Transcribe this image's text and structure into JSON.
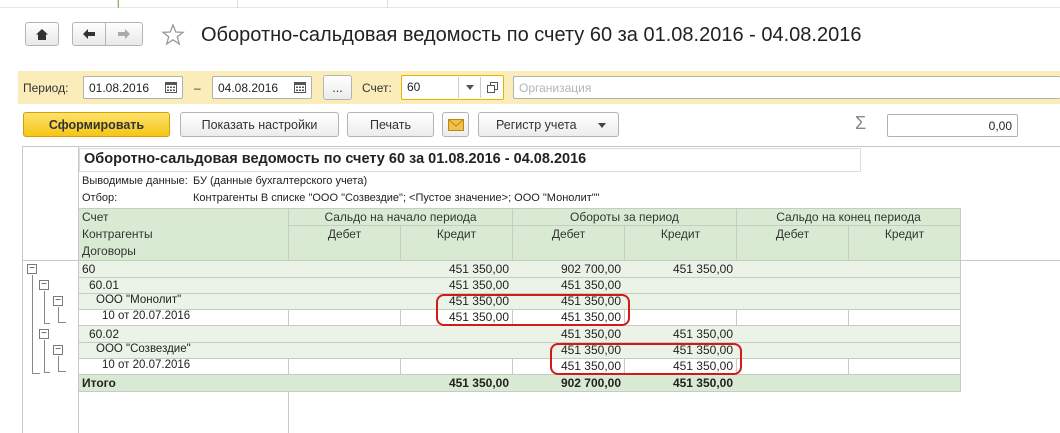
{
  "title": "Оборотно-сальдовая ведомость по счету 60 за 01.08.2016 - 04.08.2016",
  "icons": {
    "home": "home-icon",
    "back": "arrow-left-icon",
    "forward": "arrow-right-icon",
    "favorite": "star-icon",
    "calendar": "calendar-icon",
    "dropdown": "chevron-down-icon",
    "open": "open-window-icon",
    "email": "envelope-icon",
    "sum": "sigma-icon"
  },
  "filters": {
    "period_label": "Период:",
    "date_from": "01.08.2016",
    "dash": "–",
    "date_to": "04.08.2016",
    "more_label": "...",
    "account_label": "Счет:",
    "account_value": "60",
    "organization_placeholder": "Организация"
  },
  "toolbar": {
    "generate": "Сформировать",
    "show_settings": "Показать настройки",
    "print": "Печать",
    "register": "Регистр учета",
    "sum_symbol": "Σ",
    "sum_value": "0,00"
  },
  "report": {
    "title": "Оборотно-сальдовая ведомость по счету 60 за 01.08.2016 - 04.08.2016",
    "output_label": "Выводимые данные:",
    "output_value": "БУ (данные бухгалтерского учета)",
    "filter_label": "Отбор:",
    "filter_value": "Контрагенты В списке \"ООО \"Созвездие\"; <Пустое значение>; ООО \"Монолит\"\"",
    "header": {
      "account": "Счет",
      "counterparties": "Контрагенты",
      "contracts": "Договоры",
      "opening": "Сальдо на начало периода",
      "turnover": "Обороты за период",
      "closing": "Сальдо на конец периода",
      "debit": "Дебет",
      "credit": "Кредит"
    },
    "rows": [
      {
        "name": "60",
        "open_debit": "",
        "open_credit": "451 350,00",
        "turn_debit": "902 700,00",
        "turn_credit": "451 350,00",
        "close_debit": "",
        "close_credit": ""
      },
      {
        "name": "60.01",
        "open_debit": "",
        "open_credit": "451 350,00",
        "turn_debit": "451 350,00",
        "turn_credit": "",
        "close_debit": "",
        "close_credit": ""
      },
      {
        "name": "ООО \"Монолит\"",
        "open_debit": "",
        "open_credit": "451 350,00",
        "turn_debit": "451 350,00",
        "turn_credit": "",
        "close_debit": "",
        "close_credit": ""
      },
      {
        "name": "10 от 20.07.2016",
        "open_debit": "",
        "open_credit": "451 350,00",
        "turn_debit": "451 350,00",
        "turn_credit": "",
        "close_debit": "",
        "close_credit": ""
      },
      {
        "name": "60.02",
        "open_debit": "",
        "open_credit": "",
        "turn_debit": "451 350,00",
        "turn_credit": "451 350,00",
        "close_debit": "",
        "close_credit": ""
      },
      {
        "name": "ООО \"Созвездие\"",
        "open_debit": "",
        "open_credit": "",
        "turn_debit": "451 350,00",
        "turn_credit": "451 350,00",
        "close_debit": "",
        "close_credit": ""
      },
      {
        "name": "10 от 20.07.2016",
        "open_debit": "",
        "open_credit": "",
        "turn_debit": "451 350,00",
        "turn_credit": "451 350,00",
        "close_debit": "",
        "close_credit": ""
      }
    ],
    "total": {
      "name": "Итого",
      "open_debit": "",
      "open_credit": "451 350,00",
      "turn_debit": "902 700,00",
      "turn_credit": "451 350,00",
      "close_debit": "",
      "close_credit": ""
    }
  },
  "colors": {
    "filterbar": "#fbedb9",
    "header": "#d9ead3",
    "group_row": "#eaf3e6",
    "primary_button": "#f5c517",
    "annotation": "#d11a1a"
  }
}
